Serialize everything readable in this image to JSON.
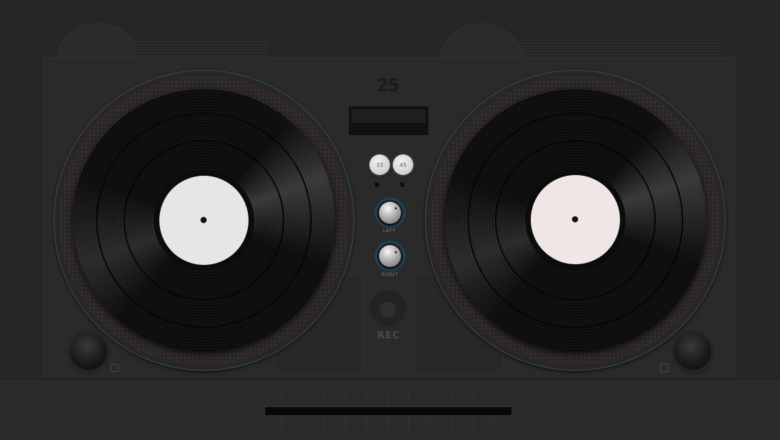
{
  "app": {
    "name": "DJ turntables"
  },
  "logo": {
    "text": "25"
  },
  "mixer": {
    "speed_buttons": [
      {
        "label": "33"
      },
      {
        "label": "45"
      }
    ],
    "knobs": [
      {
        "label": "LEFT"
      },
      {
        "label": "RIGHT"
      }
    ],
    "record": {
      "label": "REC"
    }
  },
  "decks": [
    {
      "side": "left",
      "label_color": "#e6e6e6"
    },
    {
      "side": "right",
      "label_color": "#f1e6e6"
    }
  ],
  "colors": {
    "background": "#262626",
    "accent_ring": "#1f4a63",
    "platter_edge": "#3a5068"
  },
  "icons": [
    "corner-knob",
    "settings-small-icon",
    "crossfader"
  ]
}
